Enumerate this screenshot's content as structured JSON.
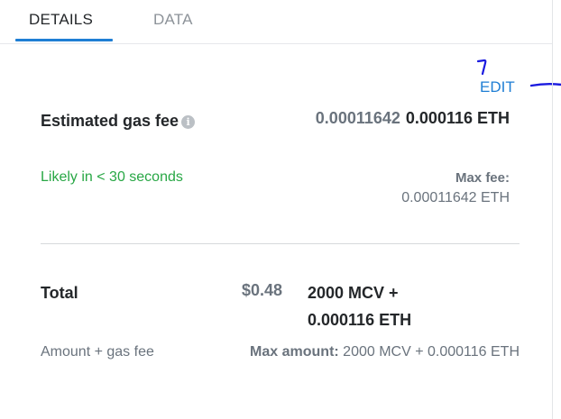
{
  "tabs": [
    {
      "label": "DETAILS"
    },
    {
      "label": "DATA"
    }
  ],
  "edit_label": "EDIT",
  "gas": {
    "title": "Estimated gas fee",
    "info_icon": "info-circle-icon",
    "secondary_value": "0.00011642",
    "primary_value": "0.000116 ETH",
    "likely_text": "Likely in < 30 seconds",
    "max_fee_label": "Max fee:",
    "max_fee_value": "0.00011642 ETH"
  },
  "total": {
    "title": "Total",
    "fiat_value": "$0.48",
    "token_value": "2000 MCV + 0.000116 ETH",
    "subtitle": "Amount + gas fee",
    "max_amount_label": "Max amount:",
    "max_amount_value": "2000 MCV + 0.000116 ETH"
  },
  "colors": {
    "accent": "#1f7ed4",
    "success": "#28a745",
    "muted": "#6a737d",
    "annotation": "#1a1adf"
  }
}
